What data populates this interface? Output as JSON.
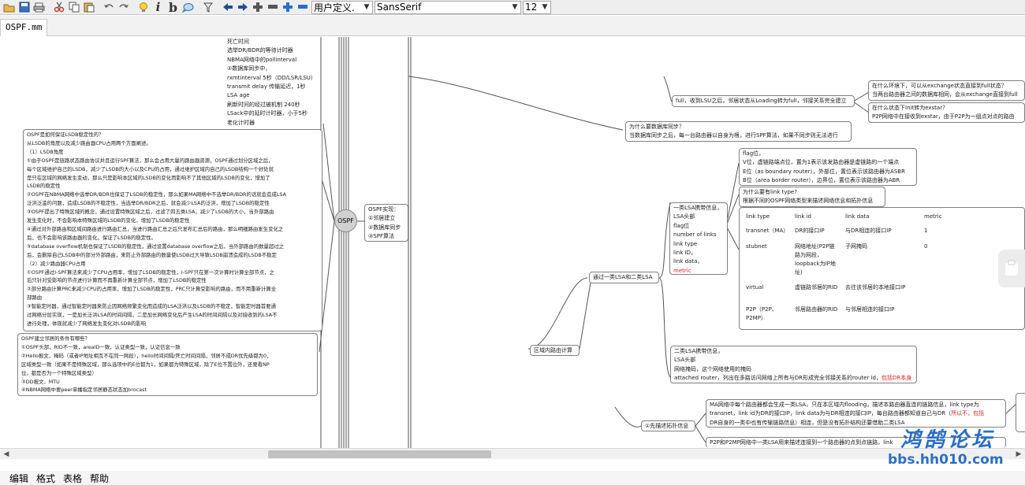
{
  "toolbar": {
    "bold_label": "b",
    "italic_label": "i",
    "style_combo": "用户定义.",
    "font_combo": "SansSerif",
    "size_combo": "12"
  },
  "tab": {
    "title": "OSPF.mm"
  },
  "center": {
    "label": "OSPF"
  },
  "nodes": {
    "top_timers": [
      "死亡时间",
      "选举DR/BDR的等待计时器",
      "NBMA网络中的pollinterval",
      "②数据库同步中，",
      "rxmtinterval   5秒（DD/LSR/LSU）",
      "transmit delay    传输延迟，1秒",
      "LSA age",
      "刷新时间的经过被机制 240秒",
      "LSack中的延时计时器，小于5秒",
      "老化计时器"
    ],
    "lsdb_stability": [
      "OSPF是如何保证LSDB稳定性的？",
      "从LSDB的角度以及减少路由器CPU占用两个方面阐述。",
      "（1）LSDB角度",
      "①由于OSPF是链路状态路由协议并且运行SPF算法，那么会占用大量的路由器资源，OSPF通过划分区域之后，",
      "每个区域维护自己的LSDB，减少了LSDB的大小以及CPU的占用，通过维护区域内自己的LSDB结构一个好处就",
      "是只在区域的网络发生变动，那么只是影响本区域的LSDB的变化而影响不了其他区域的LSDB的变化，增加了",
      "LSDB的稳定性",
      "②OSPF在NBMA网络中选举DR/BDR也保证了LSDB的稳定性，那么如果MA网络中不选举DR/BDR的话就会造成LSA",
      "泛洪泛滥的问题，造成LSDB的不稳定性，当选举DR/BDR之后，就会减少LSA的泛洪，增加了LSDB的稳定性",
      "③OSPF提出了特殊区域的概念，通过设置特殊区域之后，过滤了四五类LSA，减少了LSDB的大小，当外部路由",
      "发生变化时，不会影响本特殊区域的LSDB的变化，增加了LSDB的稳定性",
      "④通过对外部路由和区域间路由进行路由汇总，当进行路由汇总之后只发布汇总后的路由，那么明细路由发生变化之",
      "后，也不会影响该路由器的变化，保证了LSDB的稳定性。",
      "⑤database overflow机制也保证了LSDB的稳定性，通过设置database overflow之后，当外部路由的数量超过之",
      "后，会删除自己LSDB中的部分外部路由，来防止外部路由的数量使LSDB过大导致LSDB崩溃造成的LSDB不稳定",
      "（2）减少路由器CPU占用",
      "①OSPF通过I-SPF算法来减少了CPU占用率，增加了LSDB的稳定性，I-SPF只在第一次计算时计算全部节点，之",
      "后只针对受影响的节点进行计算而不再重新计算全部节点，增加了LSDB的稳定性",
      "②部分路由计算PRC来减少CPU的占用率，增加了LSDB的稳定性，PRC只计算受影响的路由，而不用重新计算全",
      "部路由",
      "③智能定时器，通过智能定时器来防止因网络频繁变化而造成的LSA泛洪以及LSDB的不稳定，智能定时器首要通",
      "过网络分层实现，一是加长泛洪LSA的时间间隔，二是加长网络变化后产生LSA的时间间隔以及对接收到的LSA不",
      "进行处理，体现就减少了网络发生变化对LSDB的影响"
    ],
    "neighbor_conditions": [
      "OSPF建立邻居的条件有哪些？",
      "①OSPF头部，RID不一致，areaID一致，认证类型一致，认证信息一致",
      "②Hello报文，掩码（或者IP地址相互不在同一网段），hello时间间隔/死亡时间间隔，邻居不成DR优先级都为0，",
      "区域类型一致（如果不是特殊区域，那么选项中的E位都为1，如果都为特殊区域，除了E位不置位外，还要看NP",
      "位，都是否为一个特殊区域类型）",
      "③DD报文，MTU",
      "④NBMA网络中要peer单播指定邻居静态状态加brocast"
    ],
    "ospf_features": [
      "OSPF实现：",
      "①邻居建立",
      "②数据库同步",
      "③SPF算法"
    ],
    "full_state": "full，收到LSU之后，邻居状态从Loading转为full，邻接关系完全建立",
    "q1_exchange": [
      "在什么环境下，可以从exchange状态直接到full状态？",
      "当两台路由器之间的数据库相同，会从exchange直接到full"
    ],
    "q2_exstart": [
      "在什么状态下Init转为exstar？",
      "P2P网络中在接收到exstar，由于P2P为一组点对点的路由"
    ],
    "why_sync": [
      "为什么要数据库同步？",
      "当数据库同步之后，每一台路由器以自身为根，进行SPF算法，如果不同步则无法进行"
    ],
    "flag_bits": [
      "flag位，",
      "V位，虚链路端点位，置为1表示该发路由器是虚链路的一个端点",
      "E位（as boundary router），外部位，置位表示该路由器为ASBR",
      "B位（area border router），边界位，置位表示该路由器为ABR"
    ],
    "why_link_type": [
      "为什么要有link type?",
      "根据不同的OSPF网络类型来描述网络信息和拓扑信息"
    ],
    "lsa1_fields": [
      "一类LSA携带信息，",
      "LSA头部",
      "flag位",
      "number of links",
      "link type",
      "link ID，",
      "link data，",
      "metric"
    ],
    "link_table": {
      "headers": [
        "link type",
        "link id",
        "link data",
        "metric"
      ],
      "rows": [
        [
          "transnet（MA）",
          "DR的接口IP",
          "与DR相连的接口IP",
          "1"
        ],
        [
          "stubnet",
          "网络地址(P2P链路为网段，loopback为IP地址)",
          "子网掩码",
          "0"
        ],
        [
          "virtual",
          "虚链路邻居的RID",
          "去往该邻居的本地接口IP",
          ""
        ],
        [
          "P2P（P2P、P2MP）",
          "邻居路由器的RID",
          "与邻居相连的接口IP",
          ""
        ]
      ]
    },
    "lsa_12": "通过一类LSA和二类LSA",
    "lsa2": [
      "二类LSA携带信息，",
      "LSA头部",
      "网络掩码，这个网络使用的掩码",
      "attached router，列出在多路访问网络上所有与DR形成完全邻接关系的router id，"
    ],
    "lsa2_red": "包括DR本身",
    "intra_area": "区域内路由计算",
    "topo_desc": "①先描述拓扑信息",
    "ma_desc": [
      "MA网络中每个路由器都会生成一类LSA，只在本区域内flooding，描述本路由器直连的链路信息，link type为",
      "transnet，link id为DR的接口IP，link data为与DR相连的接口IP，每台路由器都知道自己与DR（",
      "DR自身的一类中也有传输链路信息）相连，但是没有拓扑结构还要借助二类LSA"
    ],
    "ma_red": "所以不，包括",
    "p2p_desc": "P2P和P2MP网络中一类LSA用来描述连接到一个路由器的点到点链路，link"
  },
  "scrollbar": {
    "thumb_position": 0.26
  },
  "menu": [
    "编辑",
    "格式",
    "表格",
    "帮助"
  ],
  "watermark": {
    "title": "鸿鹄论坛",
    "url": "bbs.hh010.com"
  },
  "colors": {
    "node_border": "#7f7f7f",
    "link": "#555555",
    "red_text": "#e02020",
    "watermark": "#2b6fc2"
  }
}
